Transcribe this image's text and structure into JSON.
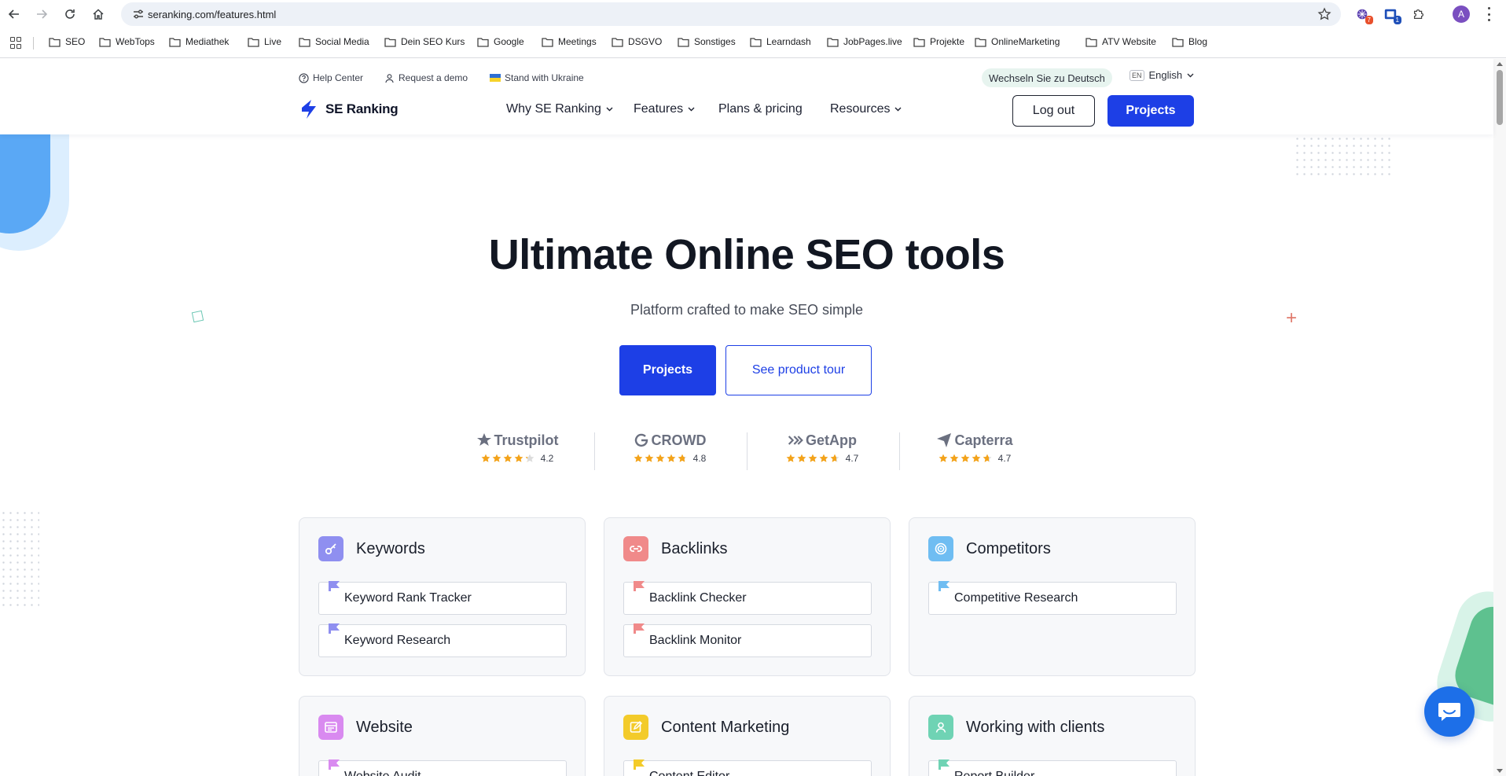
{
  "browser": {
    "url": "seranking.com/features.html",
    "avatar_letter": "A",
    "ext_badges": [
      "7",
      "1"
    ],
    "bookmarks": [
      "SEO",
      "WebTops",
      "Mediathek",
      "Live",
      "Social Media",
      "Dein SEO Kurs",
      "Google",
      "Meetings",
      "DSGVO",
      "Sonstiges",
      "Learndash",
      "JobPages.live",
      "Projekte",
      "OnlineMarketing",
      "ATV Website",
      "Blog"
    ]
  },
  "header": {
    "util": {
      "help": "Help Center",
      "demo": "Request a demo",
      "ukraine": "Stand with Ukraine"
    },
    "lang_switch": "Wechseln Sie zu Deutsch",
    "lang_code": "EN",
    "lang_name": "English",
    "logo_text": "SE Ranking",
    "nav": {
      "why": "Why SE Ranking",
      "features": "Features",
      "plans": "Plans & pricing",
      "resources": "Resources"
    },
    "logout": "Log out",
    "projects": "Projects"
  },
  "hero": {
    "title": "Ultimate Online SEO tools",
    "subtitle": "Platform crafted to make SEO simple",
    "primary_button": "Projects",
    "secondary_button": "See product tour"
  },
  "ratings": [
    {
      "brand": "Trustpilot",
      "score": "4.2",
      "stars": 4.2
    },
    {
      "brand": "CROWD",
      "score": "4.8",
      "stars": 4.8
    },
    {
      "brand": "GetApp",
      "score": "4.7",
      "stars": 4.7
    },
    {
      "brand": "Capterra",
      "score": "4.7",
      "stars": 4.7
    }
  ],
  "cards": [
    {
      "title": "Keywords",
      "items": [
        "Keyword Rank Tracker",
        "Keyword Research"
      ],
      "color": "#8f8ff0"
    },
    {
      "title": "Backlinks",
      "items": [
        "Backlink Checker",
        "Backlink Monitor"
      ],
      "color": "#f08a8a"
    },
    {
      "title": "Competitors",
      "items": [
        "Competitive Research"
      ],
      "color": "#6fbdf2"
    },
    {
      "title": "Website",
      "items": [
        "Website Audit"
      ],
      "color": "#d98af0"
    },
    {
      "title": "Content Marketing",
      "items": [
        "Content Editor"
      ],
      "color": "#f3cb2a"
    },
    {
      "title": "Working with clients",
      "items": [
        "Report Builder"
      ],
      "color": "#6fd3b4"
    }
  ],
  "colors": {
    "brand_blue": "#1d3fe6",
    "star_gold": "#f3a31b"
  }
}
